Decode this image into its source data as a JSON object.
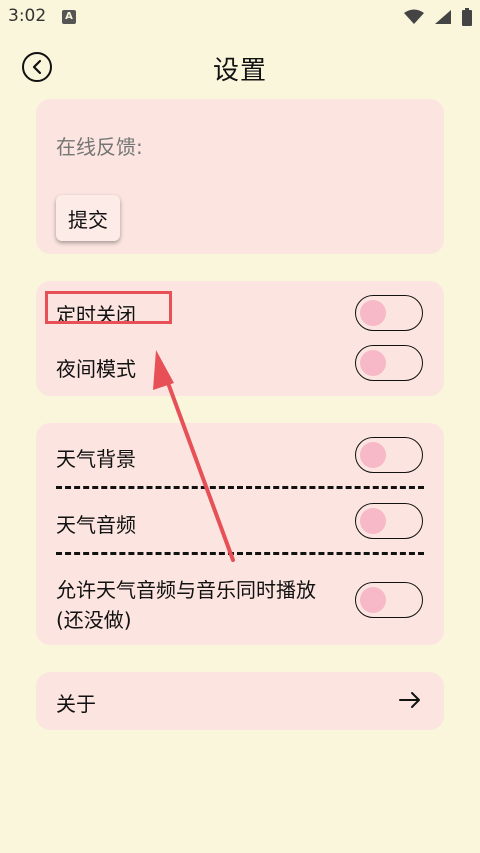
{
  "status_bar": {
    "time": "3:02",
    "notification_icon": "A"
  },
  "header": {
    "title": "设置"
  },
  "feedback": {
    "placeholder": "在线反馈:",
    "submit_label": "提交"
  },
  "timer_section": {
    "timed_close_label": "定时关闭",
    "timed_close_on": false,
    "night_mode_label": "夜间模式",
    "night_mode_on": false
  },
  "weather_section": {
    "background_label": "天气背景",
    "background_on": false,
    "audio_label": "天气音频",
    "audio_on": false,
    "simultaneous_label_line1": "允许天气音频与音乐同时播放",
    "simultaneous_label_line2": "(还没做)",
    "simultaneous_on": false
  },
  "about": {
    "label": "关于"
  },
  "colors": {
    "background": "#f9f6dc",
    "card": "#fce5e0",
    "toggle_knob": "#f7b9c8",
    "annotation": "#e85058"
  }
}
